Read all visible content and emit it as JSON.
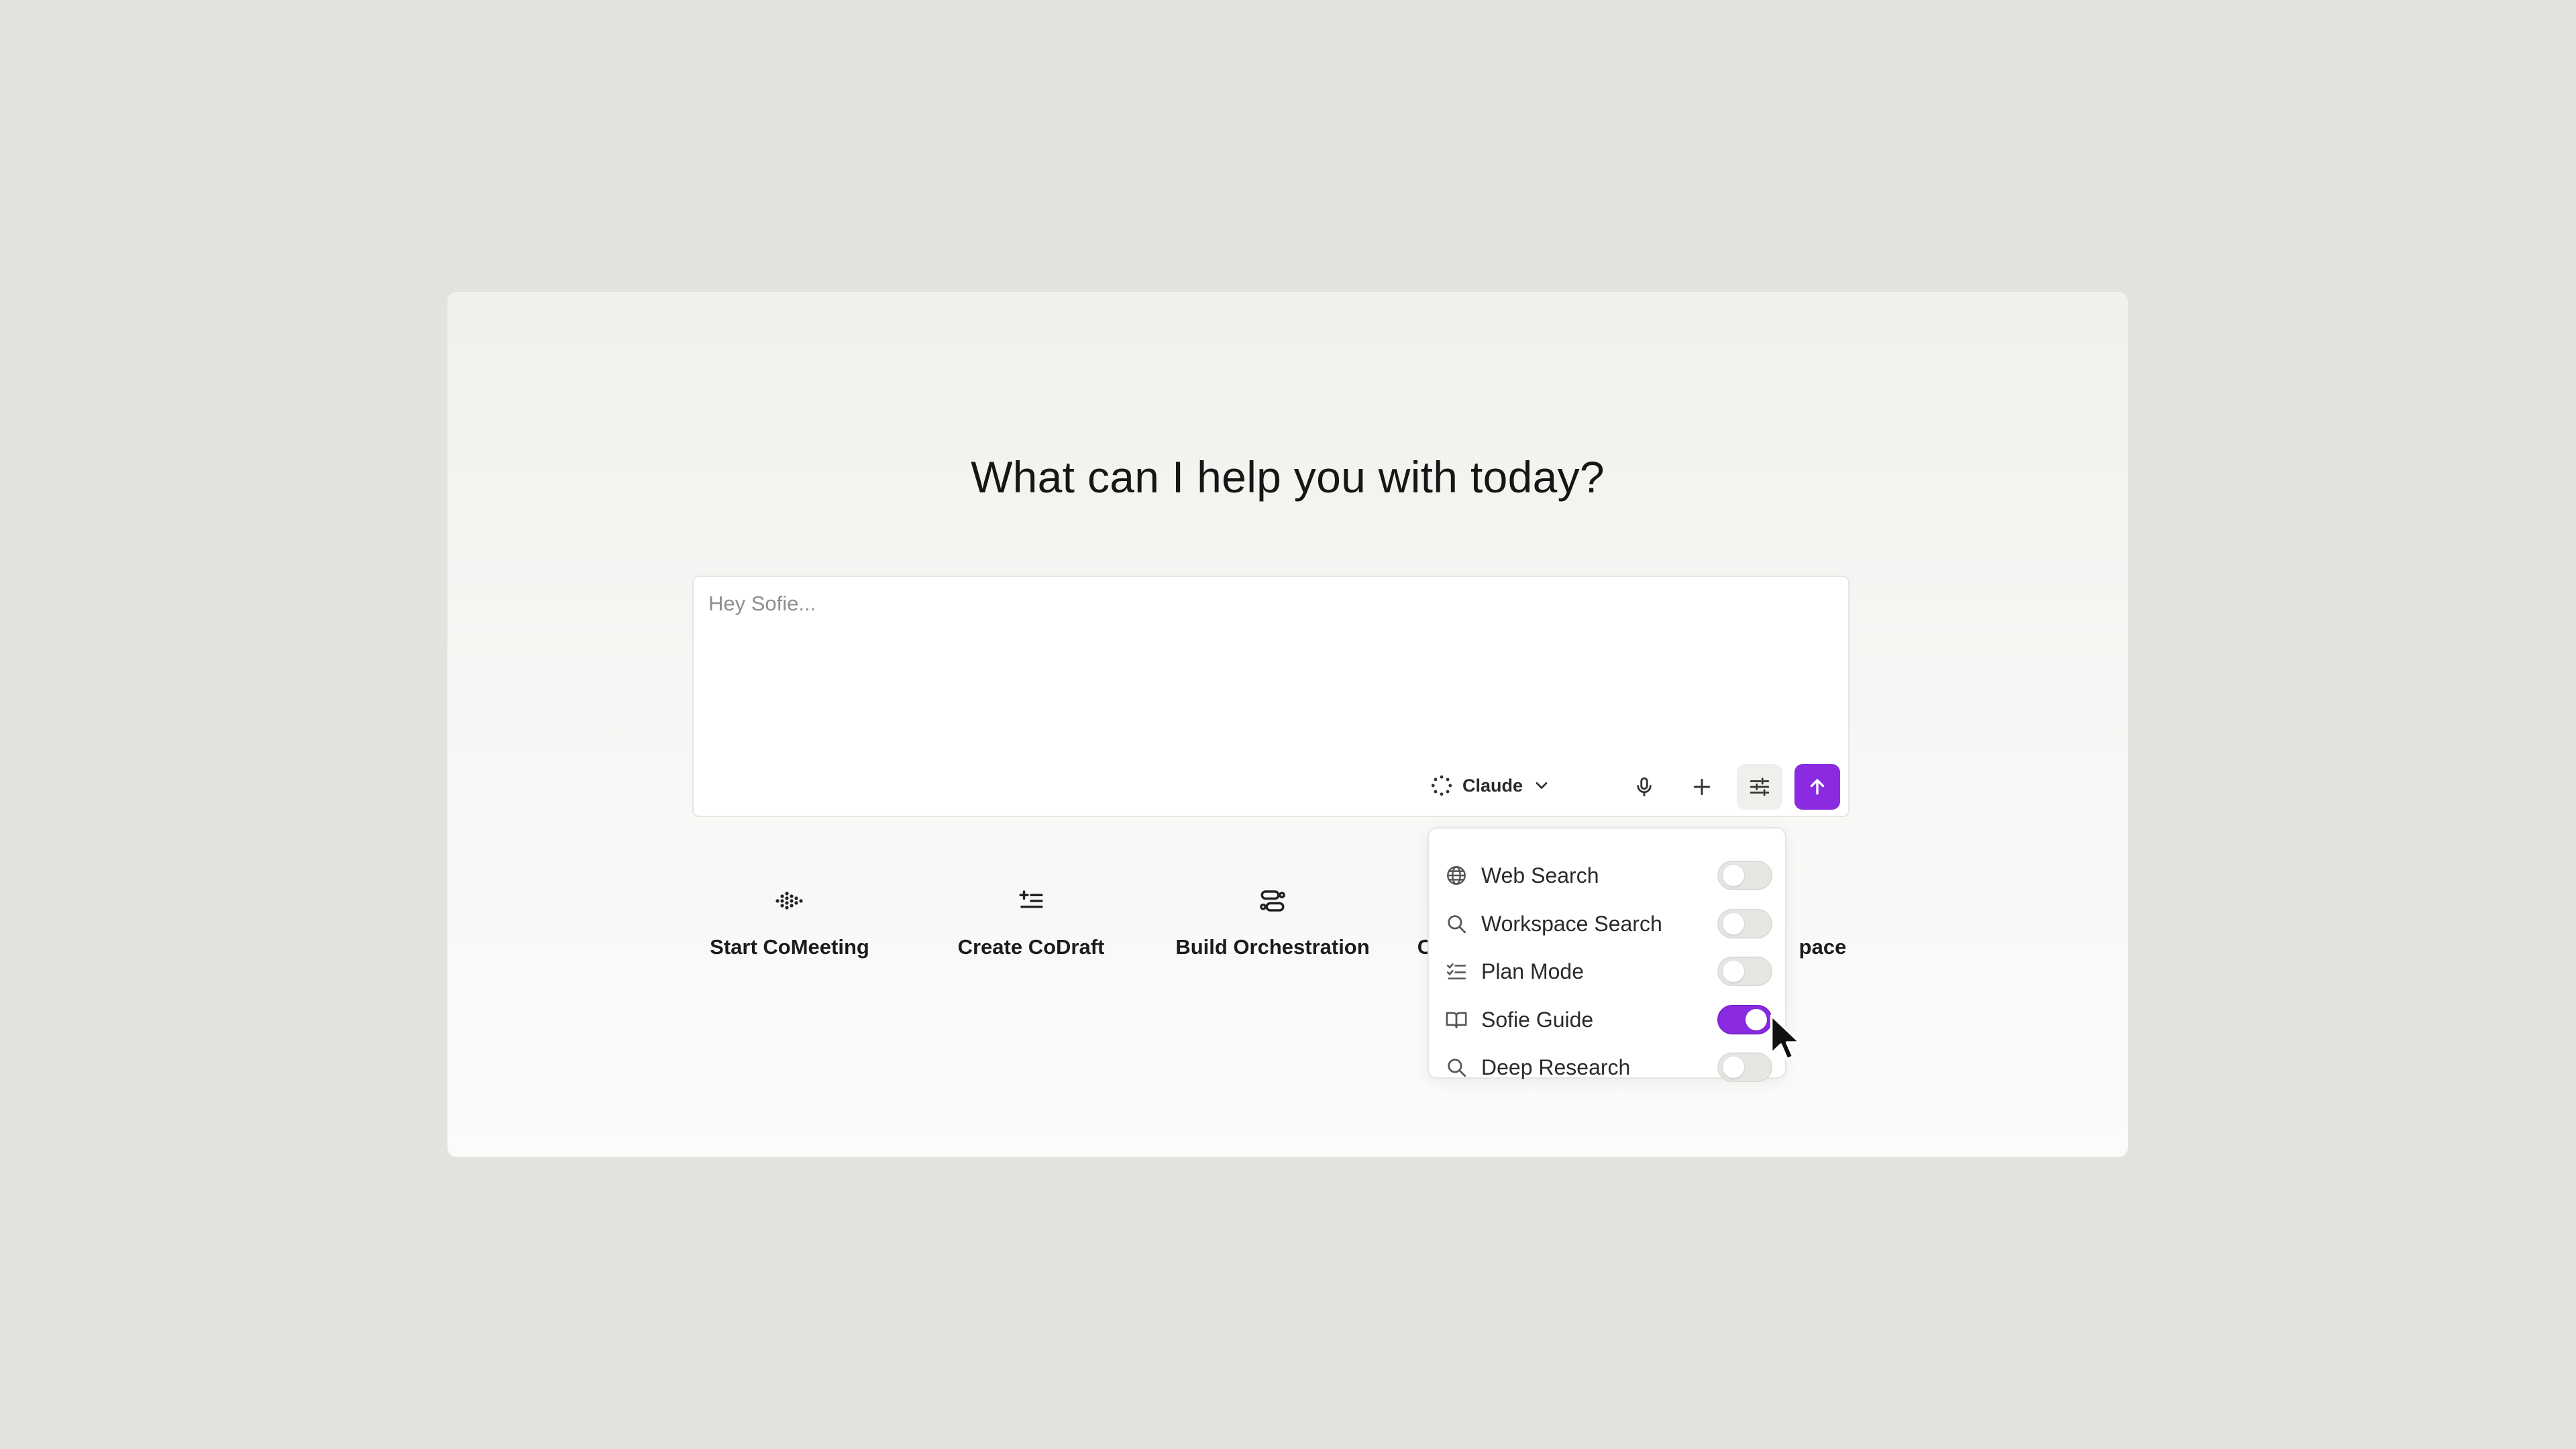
{
  "heading": "What can I help you with today?",
  "composer": {
    "placeholder": "Hey Sofie...",
    "model": "Claude"
  },
  "actions": [
    {
      "label": "Start CoMeeting",
      "icon": "equalizer-dots-icon"
    },
    {
      "label": "Create CoDraft",
      "icon": "add-list-icon"
    },
    {
      "label": "Build Orchestration",
      "icon": "workflow-icon"
    },
    {
      "label": "C",
      "icon": "hidden"
    },
    {
      "label": "pace",
      "icon": "hidden"
    }
  ],
  "menu": {
    "items": [
      {
        "label": "Web Search",
        "icon": "globe-icon",
        "on": false
      },
      {
        "label": "Workspace Search",
        "icon": "search-icon",
        "on": false
      },
      {
        "label": "Plan Mode",
        "icon": "checklist-icon",
        "on": false
      },
      {
        "label": "Sofie Guide",
        "icon": "book-icon",
        "on": true
      },
      {
        "label": "Deep Research",
        "icon": "search-icon",
        "on": false
      }
    ]
  },
  "colors": {
    "accent": "#8a2be2",
    "background": "#e3e2de",
    "panel": "#f6f6f4"
  }
}
